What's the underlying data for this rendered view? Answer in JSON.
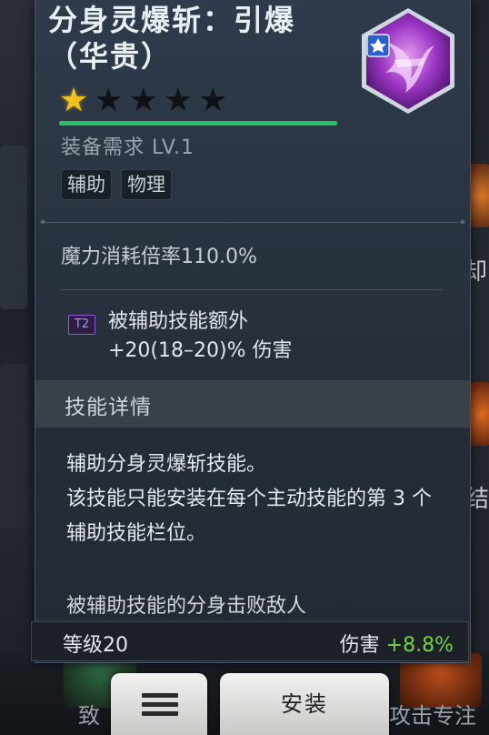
{
  "skill": {
    "title": "分身灵爆斩：引爆（华贵）",
    "stars_total": 5,
    "stars_filled": 1,
    "xp_fraction": 1.0,
    "requirement": "装备需求 LV.1",
    "tags": [
      "辅助",
      "物理"
    ],
    "mana_multiplier": "魔力消耗倍率110.0%",
    "tier_badge": "T2",
    "tier_line1": "被辅助技能额外",
    "tier_line2": "+20(18–20)% 伤害",
    "details_header": "技能详情",
    "desc_line1": "辅助分身灵爆斩技能。",
    "desc_line2": "该技能只能安装在每个主动技能的第 3 个辅助技能栏位。",
    "desc_cut": "被辅助技能的分身击败敌人",
    "level_label": "等级20",
    "damage_label": "伤害",
    "damage_value": "+8.8%"
  },
  "buttons": {
    "install_label": "安装",
    "menu_icon": "hamburger-icon"
  },
  "background": {
    "right_top": "却",
    "right_mid": "结",
    "bottom_left": "致",
    "bottom_right": "攻击专注"
  },
  "colors": {
    "star_on": "#f2c11c",
    "xp_bar": "#28c064",
    "damage_positive": "#74d24a",
    "tier_badge": "#8f5ad1"
  }
}
